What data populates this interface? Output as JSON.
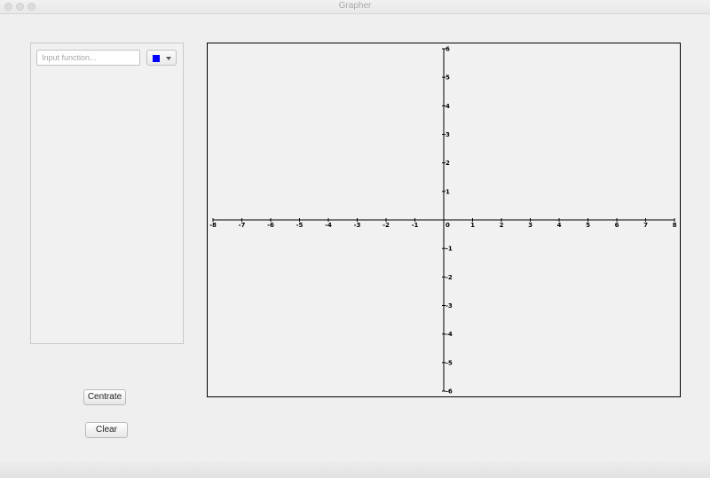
{
  "window": {
    "title": "Grapher"
  },
  "function_panel": {
    "input": {
      "placeholder": "Input function...",
      "value": ""
    },
    "color_picker": {
      "selected_color": "#0000ff",
      "icon": "chevron-down-icon"
    }
  },
  "buttons": {
    "centrate_label": "Centrate",
    "clear_label": "Clear"
  },
  "graph": {
    "x_range": [
      -8,
      8
    ],
    "y_range": [
      -6,
      6
    ],
    "x_ticks": [
      "-8",
      "-7",
      "-6",
      "-5",
      "-4",
      "-3",
      "-2",
      "-1",
      "0",
      "1",
      "2",
      "3",
      "4",
      "5",
      "6",
      "7",
      "8"
    ],
    "y_ticks": [
      "6",
      "5",
      "4",
      "3",
      "2",
      "1",
      "-1",
      "-2",
      "-3",
      "-4",
      "-5",
      "-6"
    ],
    "functions": []
  }
}
